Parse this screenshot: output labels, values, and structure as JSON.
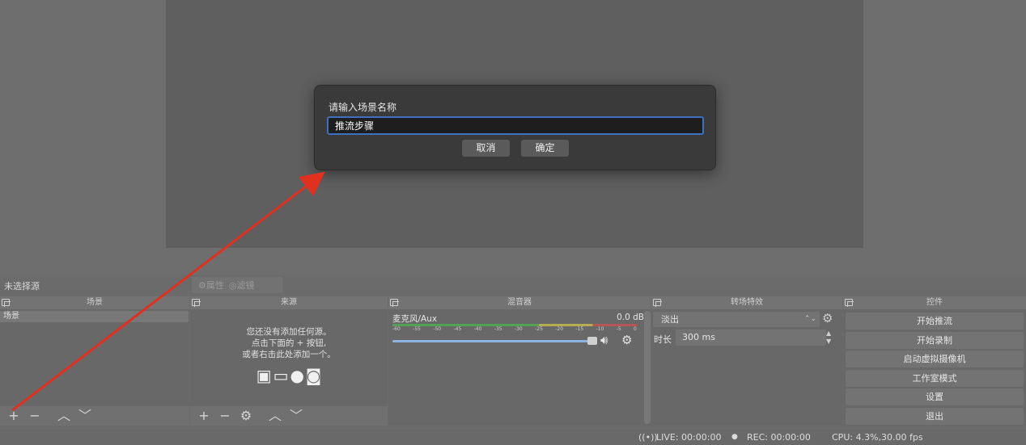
{
  "dialog": {
    "prompt": "请输入场景名称",
    "input_value": "推流步骤",
    "cancel_label": "取消",
    "ok_label": "确定"
  },
  "bottom": {
    "no_source_label": "未选择源",
    "properties_label": "属性",
    "filters_label": "滤镜"
  },
  "scenes": {
    "title": "场景",
    "items": [
      "场景"
    ]
  },
  "sources": {
    "title": "来源",
    "empty_lines": [
      "您还没有添加任何源。",
      "点击下面的 + 按钮,",
      "或者右击此处添加一个。"
    ]
  },
  "mixer": {
    "title": "混音器",
    "channel_name": "麦克风/Aux",
    "channel_db": "0.0 dB",
    "scale": [
      "-60",
      "-55",
      "-50",
      "-45",
      "-40",
      "-35",
      "-30",
      "-25",
      "-20",
      "-15",
      "-10",
      "-5",
      "0"
    ]
  },
  "transitions": {
    "title": "转场特效",
    "selected": "淡出",
    "duration_label": "时长",
    "duration_value": "300 ms"
  },
  "controls": {
    "title": "控件",
    "buttons": [
      "开始推流",
      "开始录制",
      "启动虚拟摄像机",
      "工作室模式",
      "设置",
      "退出"
    ]
  },
  "status": {
    "live": "LIVE: 00:00:00",
    "rec": "REC: 00:00:00",
    "cpu": "CPU: 4.3%,30.00 fps"
  },
  "colors": {
    "annotation_arrow": "#e03020",
    "input_focus": "#3f6fbf"
  }
}
